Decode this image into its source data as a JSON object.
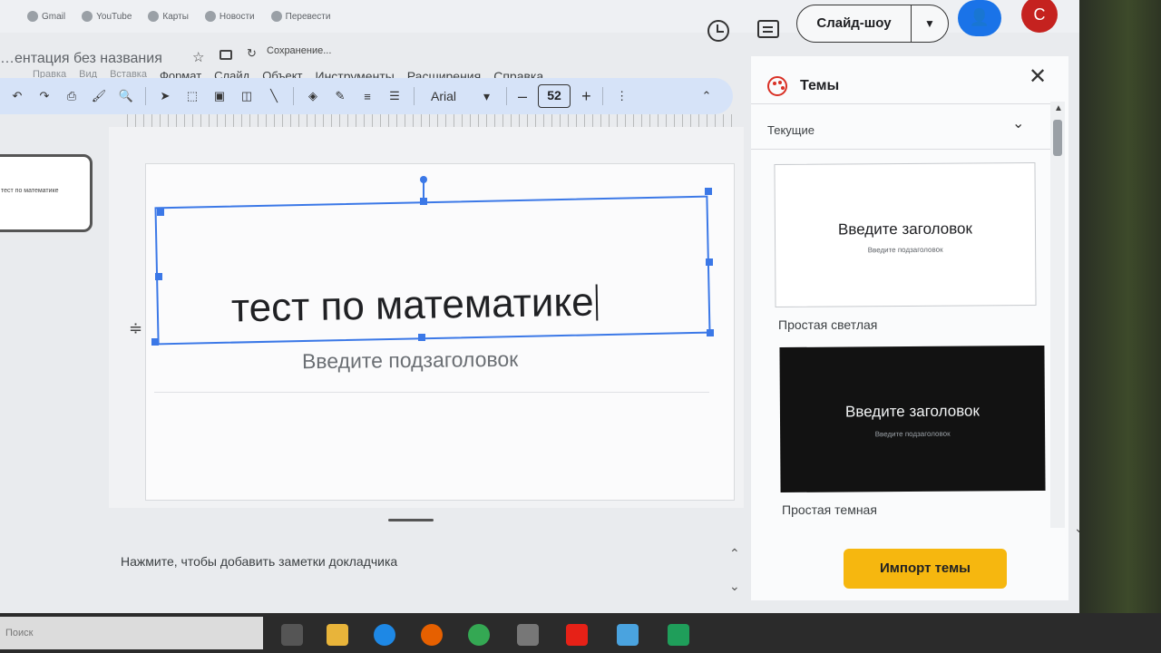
{
  "browser": {
    "bookmarks": [
      "Gmail",
      "YouTube",
      "Карты",
      "Новости",
      "Перевести"
    ]
  },
  "doc": {
    "title": "…ентация без названия",
    "save_status": "Сохранение..."
  },
  "menu": [
    "Правка",
    "Вид",
    "Вставка",
    "Формат",
    "Слайд",
    "Объект",
    "Инструменты",
    "Расширения",
    "Справка"
  ],
  "header": {
    "slideshow_label": "Слайд-шоу",
    "avatar_letter": "С"
  },
  "toolbar": {
    "font_name": "Arial",
    "font_size": "52",
    "minus": "–",
    "plus": "+"
  },
  "slides": {
    "thumb_text": "тест по математике"
  },
  "slide": {
    "title": "тест по математике",
    "subtitle_placeholder": "Введите подзаголовок"
  },
  "notes": {
    "placeholder": "Нажмите, чтобы добавить заметки докладчика"
  },
  "themes": {
    "title": "Темы",
    "section": "Текущие",
    "cards": [
      {
        "name": "Простая светлая",
        "title": "Введите заголовок",
        "subtitle": "Введите подзаголовок"
      },
      {
        "name": "Простая темная",
        "title": "Введите заголовок",
        "subtitle": "Введите подзаголовок"
      }
    ],
    "import_label": "Импорт темы"
  },
  "taskbar": {
    "search_placeholder": "Поиск"
  }
}
